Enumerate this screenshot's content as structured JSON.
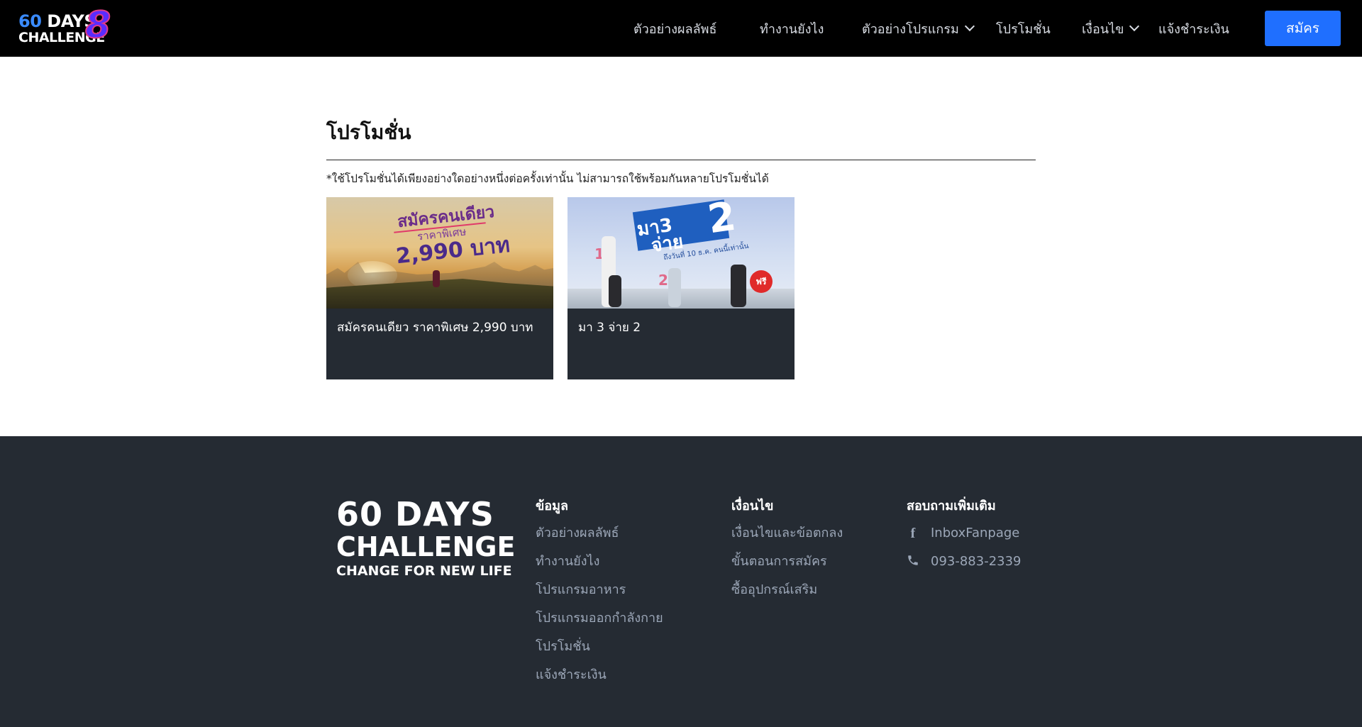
{
  "header": {
    "logo_line1_num": "60",
    "logo_line1_text": "DAYS",
    "logo_line2": "CHALLENGE",
    "logo_number": "8",
    "nav": [
      {
        "label": "ตัวอย่างผลลัพธ์",
        "dropdown": false
      },
      {
        "label": "ทำงานยังไง",
        "dropdown": false
      },
      {
        "label": "ตัวอย่างโปรแกรม",
        "dropdown": true
      },
      {
        "label": "โปรโมชั่น",
        "dropdown": false
      },
      {
        "label": "เงื่อนไข",
        "dropdown": true
      },
      {
        "label": "แจ้งชำระเงิน",
        "dropdown": false
      }
    ],
    "signup_label": "สมัคร"
  },
  "main": {
    "title": "โปรโมชั่น",
    "note": "*ใช้โปรโมชั่นได้เพียงอย่างใดอย่างหนึ่งต่อครั้งเท่านั้น ไม่สามารถใช้พร้อมกันหลายโปรโมชั่นได้",
    "cards": [
      {
        "caption": "สมัครคนเดียว ราคาพิเศษ 2,990 บาท",
        "img_line1": "สมัครคนเดียว",
        "img_line2": "ราคาพิเศษ",
        "img_line3": "2,990 บาท"
      },
      {
        "caption": "มา 3 จ่าย 2",
        "img_line1": "มา3",
        "img_line2": "จ่าย",
        "img_big": "2",
        "img_small": "ถึงวันที่ 10 ธ.ค. คนนี้เท่านั้น",
        "img_free": "ฟรี",
        "img_num1": "1",
        "img_num2": "2"
      }
    ]
  },
  "footer": {
    "logo_line1": "60 DAYS",
    "logo_line2": "CHALLENGE",
    "logo_line3": "CHANGE FOR NEW LIFE",
    "col1": {
      "heading": "ข้อมูล",
      "links": [
        "ตัวอย่างผลลัพธ์",
        "ทำงานยังไง",
        "โปรแกรมอาหาร",
        "โปรแกรมออกกำลังกาย",
        "โปรโมชั่น",
        "แจ้งชำระเงิน"
      ]
    },
    "col2": {
      "heading": "เงื่อนไข",
      "links": [
        "เงื่อนไขและข้อตกลง",
        "ขั้นตอนการสมัคร",
        "ซื้ออุปกรณ์เสริม"
      ]
    },
    "col3": {
      "heading": "สอบถามเพิ่มเติม",
      "links": [
        {
          "label": "InboxFanpage",
          "icon": "facebook-icon"
        },
        {
          "label": "093-883-2339",
          "icon": "phone-icon"
        }
      ]
    }
  },
  "colors": {
    "header_bg": "#000000",
    "accent": "#1f6fff",
    "footer_bg": "#252b33",
    "card_bg": "#252b33"
  }
}
